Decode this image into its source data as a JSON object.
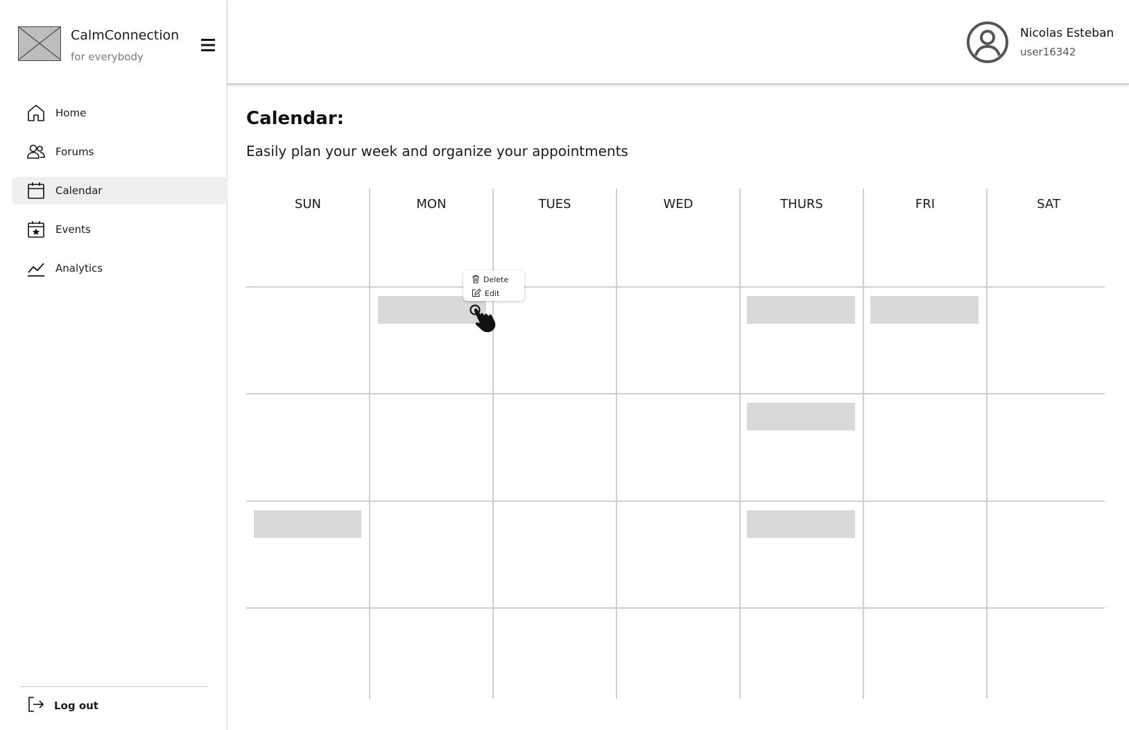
{
  "brand": {
    "name": "CalmConnection",
    "tagline": "for everybody"
  },
  "user": {
    "name": "Nicolas Esteban",
    "id": "user16342"
  },
  "nav": {
    "items": [
      {
        "label": "Home",
        "icon": "home-icon",
        "active": false
      },
      {
        "label": "Forums",
        "icon": "users-icon",
        "active": false
      },
      {
        "label": "Calendar",
        "icon": "calendar-icon",
        "active": true
      },
      {
        "label": "Events",
        "icon": "star-calendar-icon",
        "active": false
      },
      {
        "label": "Analytics",
        "icon": "chart-line-icon",
        "active": false
      }
    ],
    "logout_label": "Log out"
  },
  "page": {
    "title": "Calendar:",
    "subtitle": "Easily plan your week and organize your appointments"
  },
  "calendar": {
    "days": [
      "SUN",
      "MON",
      "TUES",
      "WED",
      "THURS",
      "FRI",
      "SAT"
    ]
  },
  "context_menu": {
    "delete_label": "Delete",
    "edit_label": "Edit"
  },
  "colors": {
    "appointment": "#d9d9d9",
    "active_nav": "#efefef",
    "grid": "#cfcfcf"
  }
}
